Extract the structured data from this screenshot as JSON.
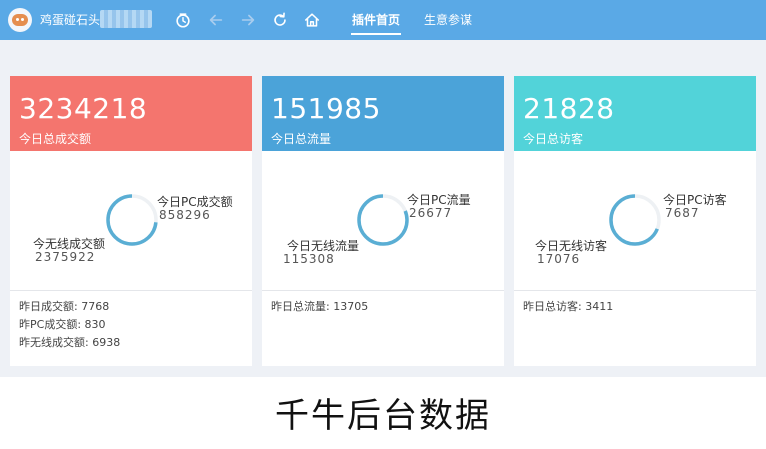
{
  "topbar": {
    "shop_name": "鸡蛋碰石头",
    "tabs": [
      {
        "label": "插件首页",
        "active": true
      },
      {
        "label": "生意参谋",
        "active": false
      }
    ],
    "icons": [
      "clock-icon",
      "back-arrow-icon",
      "forward-arrow-icon",
      "refresh-icon",
      "home-icon"
    ],
    "bg_color": "#5aa9e6"
  },
  "cards": [
    {
      "header_color": "#f4756e",
      "big_value": "3234218",
      "header_label": "今日总成交额",
      "pc_label": "今日PC成交额",
      "pc_value": "858296",
      "mobile_label": "今无线成交额",
      "mobile_value": "2375922",
      "pc_fraction": 0.265,
      "donut_color": "#5aaed4",
      "footer": [
        "昨日成交额: 7768",
        "昨PC成交额: 830",
        "昨无线成交额: 6938"
      ]
    },
    {
      "header_color": "#4ba3d9",
      "big_value": "151985",
      "header_label": "今日总流量",
      "pc_label": "今日PC流量",
      "pc_value": "26677",
      "mobile_label": "今日无线流量",
      "mobile_value": "115308",
      "pc_fraction": 0.188,
      "donut_color": "#5aaed4",
      "footer": [
        "昨日总流量: 13705"
      ]
    },
    {
      "header_color": "#52d3d9",
      "big_value": "21828",
      "header_label": "今日总访客",
      "pc_label": "今日PC访客",
      "pc_value": "7687",
      "mobile_label": "今日无线访客",
      "mobile_value": "17076",
      "pc_fraction": 0.31,
      "donut_color": "#5aaed4",
      "footer": [
        "昨日总访客: 3411"
      ]
    }
  ],
  "caption": "千牛后台数据"
}
